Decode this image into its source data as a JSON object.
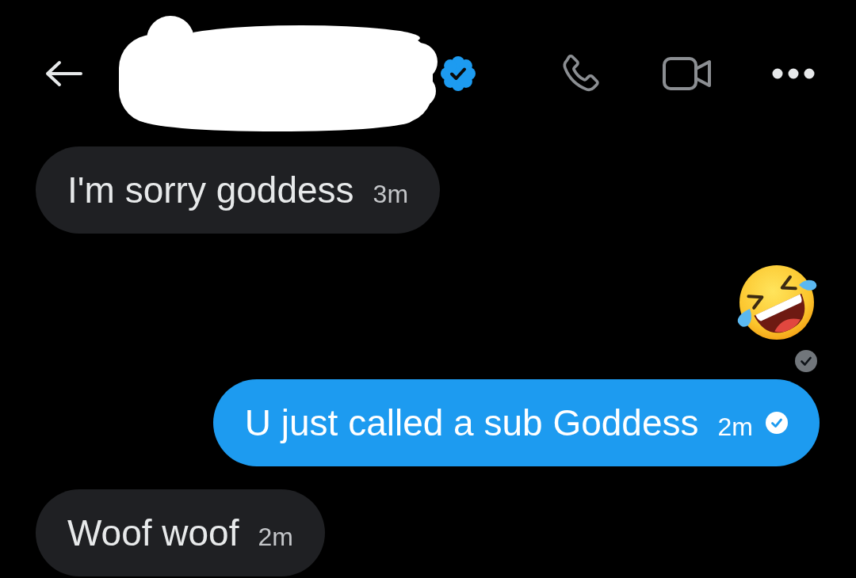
{
  "header": {
    "name_redacted": true,
    "verified": true
  },
  "messages": [
    {
      "outgoing": false,
      "kind": "text",
      "text": "I'm sorry goddess",
      "time": "3m"
    },
    {
      "outgoing": true,
      "kind": "emoji",
      "check": true
    },
    {
      "outgoing": true,
      "kind": "text",
      "text": "U just called a sub Goddess",
      "time": "2m",
      "check": true
    },
    {
      "outgoing": false,
      "kind": "text",
      "text": "Woof woof",
      "time": "2m"
    }
  ]
}
